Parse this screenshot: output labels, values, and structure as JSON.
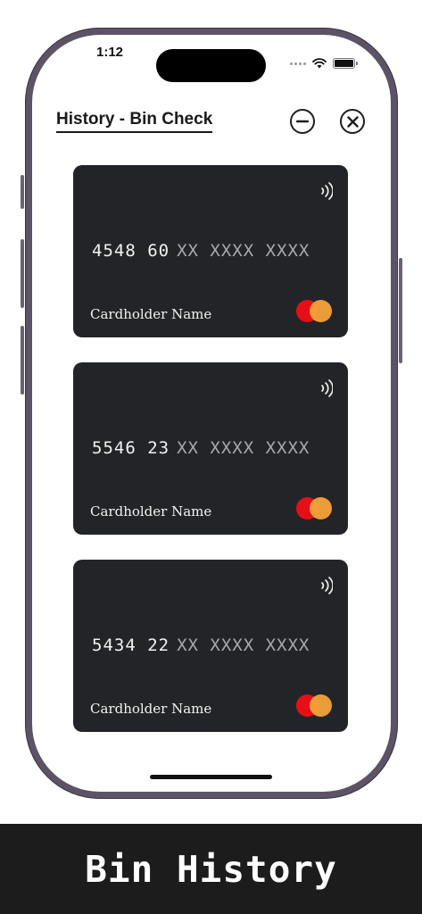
{
  "status_bar": {
    "time": "1:12"
  },
  "header": {
    "title": "History - Bin Check"
  },
  "cards": [
    {
      "bin": "4548 60",
      "masked": "XX XXXX XXXX",
      "holder": "Cardholder Name"
    },
    {
      "bin": "5546 23",
      "masked": "XX XXXX XXXX",
      "holder": "Cardholder Name"
    },
    {
      "bin": "5434 22",
      "masked": "XX XXXX XXXX",
      "holder": "Cardholder Name"
    }
  ],
  "footer": {
    "caption": "Bin History"
  },
  "colors": {
    "card_background": "#222428",
    "mastercard_red": "#e50f16",
    "mastercard_orange": "#f5a33a",
    "caption_background": "#1c1c1c"
  },
  "icons": {
    "minimize": "minus-circle-icon",
    "close": "close-circle-icon",
    "contactless": "contactless-icon",
    "card_brand": "mastercard-logo"
  }
}
